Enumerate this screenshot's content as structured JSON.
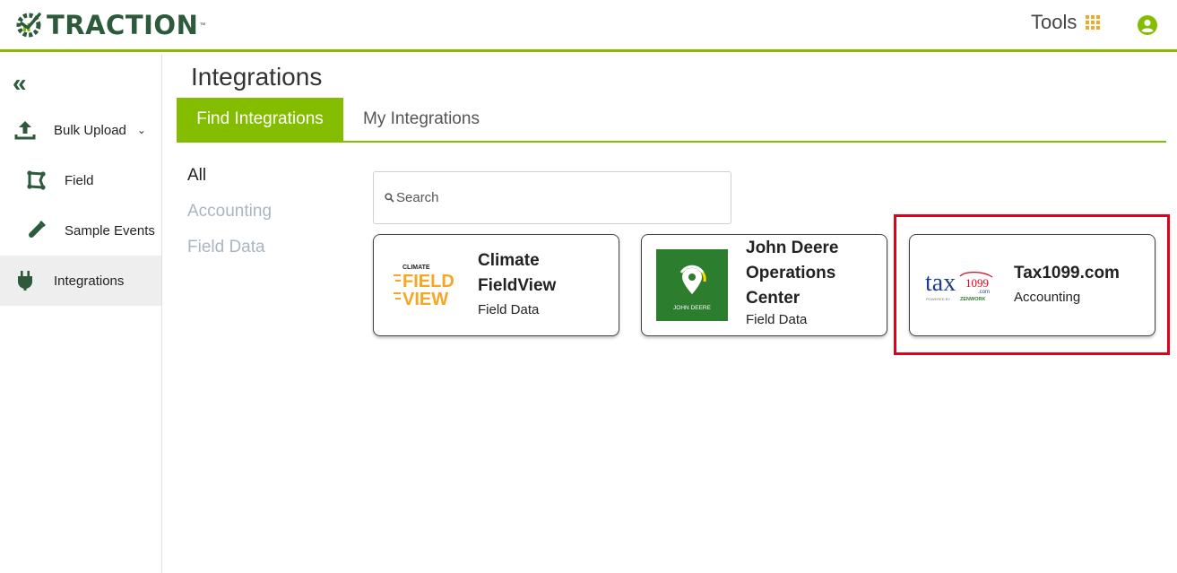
{
  "header": {
    "brand": "TRACTION",
    "brand_tm": "™",
    "tools_label": "Tools",
    "icons": {
      "grid": "grid-icon",
      "user": "user-circle-icon"
    },
    "accent_color": "#84bd00",
    "brand_color": "#2e5a3c"
  },
  "sidebar": {
    "collapse_glyph": "«",
    "items": [
      {
        "label": "Bulk Upload",
        "icon": "upload-icon",
        "has_chevron": true
      },
      {
        "label": "Field",
        "icon": "field-icon"
      },
      {
        "label": "Sample Events",
        "icon": "test-tube-icon"
      },
      {
        "label": "Integrations",
        "icon": "plug-icon",
        "active": true
      }
    ]
  },
  "main": {
    "title": "Integrations",
    "tabs": [
      {
        "label": "Find Integrations",
        "active": true
      },
      {
        "label": "My Integrations",
        "active": false
      }
    ],
    "filters": [
      {
        "label": "All",
        "active": true
      },
      {
        "label": "Accounting",
        "active": false
      },
      {
        "label": "Field Data",
        "active": false
      }
    ],
    "search": {
      "placeholder": "Search",
      "value": ""
    },
    "cards": [
      {
        "name": "Climate FieldView",
        "category": "Field Data",
        "logo": "climate-fieldview-logo",
        "logo_text": [
          "CLIMATE",
          "FIELD",
          "VIEW"
        ]
      },
      {
        "name": "John Deere Operations Center",
        "category": "Field Data",
        "logo": "john-deere-logo",
        "logo_text": "JOHN DEERE"
      },
      {
        "name": "Tax1099.com",
        "category": "Accounting",
        "logo": "tax1099-logo",
        "logo_text": [
          "tax",
          "1099",
          ".com",
          "POWERED BY",
          "ZENWORK"
        ]
      }
    ]
  }
}
